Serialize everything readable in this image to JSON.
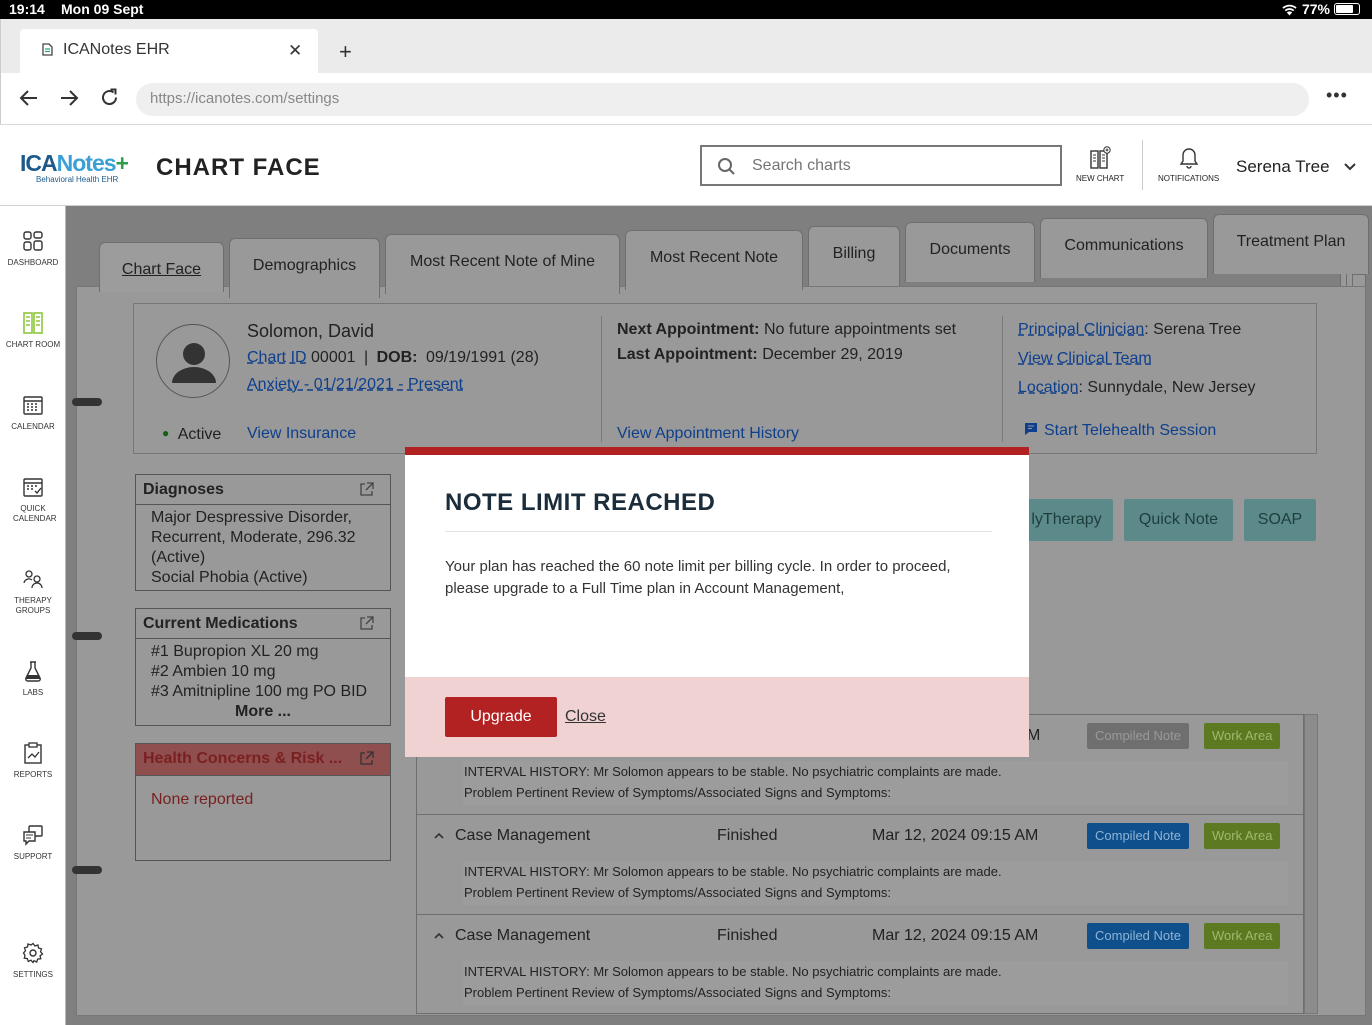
{
  "status_bar": {
    "time": "19:14",
    "date": "Mon 09 Sept",
    "battery": "77%"
  },
  "browser": {
    "tab_title": "ICANotes EHR",
    "url": "https://icanotes.com/settings"
  },
  "app": {
    "logo_text_main": "ICANotes",
    "logo_text_sub": "Behavioral Health EHR",
    "page_title": "CHART FACE",
    "search_placeholder": "Search charts",
    "new_chart_label": "NEW CHART",
    "notifications_label": "NOTIFICATIONS",
    "user_name": "Serena Tree"
  },
  "sidebar": {
    "items": [
      {
        "label": "DASHBOARD",
        "icon": "dashboard-icon"
      },
      {
        "label": "CHART ROOM",
        "icon": "chart-room-icon"
      },
      {
        "label": "CALENDAR",
        "icon": "calendar-icon"
      },
      {
        "label": "QUICK CALENDAR",
        "icon": "quick-calendar-icon"
      },
      {
        "label": "THERAPY GROUPS",
        "icon": "therapy-groups-icon"
      },
      {
        "label": "LABS",
        "icon": "labs-icon"
      },
      {
        "label": "REPORTS",
        "icon": "reports-icon"
      },
      {
        "label": "SUPPORT",
        "icon": "support-icon"
      },
      {
        "label": "SETTINGS",
        "icon": "settings-icon"
      }
    ]
  },
  "chart_tabs": [
    "Chart Face",
    "Demographics",
    "Most Recent Note of Mine",
    "Most Recent Note",
    "Billing",
    "Documents",
    "Communications",
    "Treatment Plan"
  ],
  "patient": {
    "name": "Solomon, David",
    "chart_id_label": "Chart ID",
    "chart_id": "00001",
    "separator": "|",
    "dob_label": "DOB:",
    "dob": "09/19/1991 (28)",
    "diagnosis_link": "Anxiety - 01/21/2021 - Present",
    "status": "Active",
    "view_insurance": "View Insurance",
    "next_appt_label": "Next Appointment:",
    "next_appt": "No future appointments set",
    "last_appt_label": "Last Appointment:",
    "last_appt": "December 29, 2019",
    "view_appt_history": "View Appointment History",
    "principal_clinician_label": "Principal Clinician",
    "principal_clinician": "Serena Tree",
    "view_clinical_team": "View Clinical Team",
    "location_label": "Location",
    "location": "Sunnydale, New Jersey",
    "telehealth": "Start Telehealth Session"
  },
  "cards": {
    "diagnoses": {
      "title": "Diagnoses",
      "lines": [
        "Major Despressive Disorder, Recurrent, Moderate, 296.32 (Active)",
        "Social Phobia (Active)"
      ]
    },
    "medications": {
      "title": "Current Medications",
      "lines": [
        "#1 Bupropion XL 20 mg",
        "#2 Ambien 10 mg",
        "#3 Amitnipline 100 mg PO BID"
      ],
      "more": "More ..."
    },
    "risk": {
      "title": "Health Concerns & Risk ...",
      "body": "None reported"
    }
  },
  "note_buttons": [
    "lyTherapy",
    "Quick Note",
    "SOAP"
  ],
  "notes": [
    {
      "type": "",
      "status": "",
      "time_fragment": "M",
      "compiled": "Compiled Note",
      "work": "Work Area",
      "hist1": "INTERVAL HISTORY: Mr Solomon appears to be stable. No psychiatric complaints are made.",
      "hist2": "Problem Pertinent Review of Symptoms/Associated Signs and Symptoms:"
    },
    {
      "type": "Case Management",
      "status": "Finished",
      "datetime": "Mar 12, 2024 09:15 AM",
      "compiled": "Compiled Note",
      "work": "Work Area",
      "hist1": "INTERVAL HISTORY: Mr Solomon appears to be stable. No psychiatric complaints are made.",
      "hist2": "Problem Pertinent Review of Symptoms/Associated Signs and Symptoms:"
    },
    {
      "type": "Case Management",
      "status": "Finished",
      "datetime": "Mar 12, 2024 09:15 AM",
      "compiled": "Compiled Note",
      "work": "Work Area",
      "hist1": "INTERVAL HISTORY: Mr Solomon appears to be stable. No psychiatric complaints are made.",
      "hist2": "Problem Pertinent Review of Symptoms/Associated Signs and Symptoms:"
    }
  ],
  "modal": {
    "title": "NOTE LIMIT REACHED",
    "body": "Your plan has reached the 60 note limit per billing cycle. In order to proceed, please upgrade to a Full Time plan in Account Management,",
    "upgrade": "Upgrade",
    "close": "Close"
  },
  "colors": {
    "modal_accent": "#b22222",
    "link": "#1a73e8",
    "active_nav": "#8dc63f",
    "compiled_btn": "#2a8ad4",
    "work_btn": "#8bb33b"
  }
}
